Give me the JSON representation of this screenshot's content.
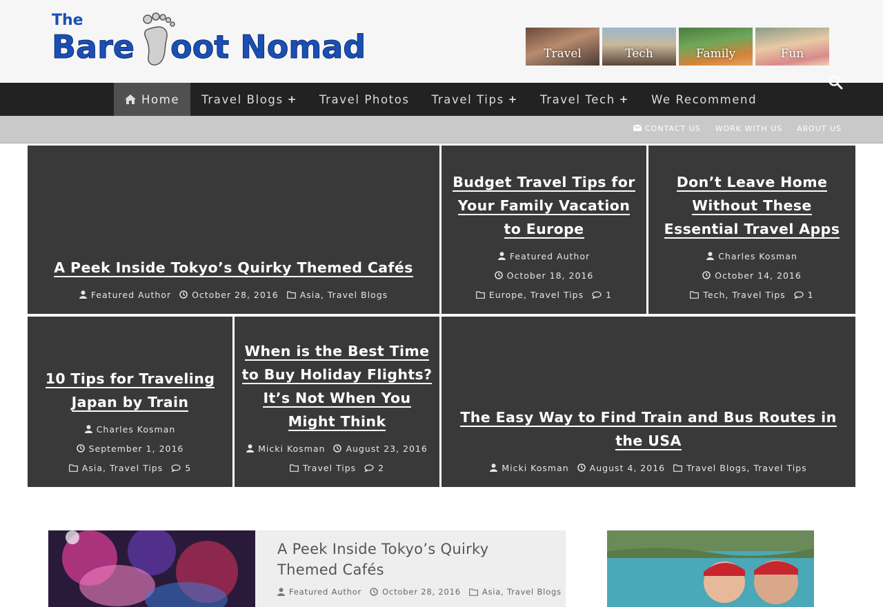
{
  "site": {
    "logo_text": "The BareFoot Nomad",
    "banner": [
      "Travel",
      "Tech",
      "Family",
      "Fun"
    ]
  },
  "nav": {
    "items": [
      {
        "label": "Home",
        "icon": "home-icon",
        "active": true,
        "has_submenu": false
      },
      {
        "label": "Travel Blogs",
        "has_submenu": true
      },
      {
        "label": "Travel Photos",
        "has_submenu": false
      },
      {
        "label": "Travel Tips",
        "has_submenu": true
      },
      {
        "label": "Travel Tech",
        "has_submenu": true
      },
      {
        "label": "We Recommend",
        "has_submenu": false
      }
    ],
    "search_icon": "search-icon"
  },
  "subnav": {
    "contact": "CONTACT US",
    "work": "WORK WITH US",
    "about": "ABOUT US"
  },
  "tiles": [
    {
      "title": "A Peek Inside Tokyo’s Quirky Themed Cafés",
      "author": "Featured Author",
      "date": "October 28, 2016",
      "categories": "Asia, Travel Blogs",
      "comments": null
    },
    {
      "title": "Budget Travel Tips for Your Family Vacation to Europe",
      "author": "Featured Author",
      "date": "October 18, 2016",
      "categories": "Europe, Travel Tips",
      "comments": "1"
    },
    {
      "title": "Don’t Leave Home Without These Essential Travel Apps",
      "author": "Charles Kosman",
      "date": "October 14, 2016",
      "categories": "Tech, Travel Tips",
      "comments": "1"
    },
    {
      "title": "10 Tips for Traveling Japan by Train",
      "author": "Charles Kosman",
      "date": "September 1, 2016",
      "categories": "Asia, Travel Tips",
      "comments": "5"
    },
    {
      "title": "When is the Best Time to Buy Holiday Flights? It’s Not When You Might Think",
      "author": "Micki Kosman",
      "date": "August 23, 2016",
      "categories": "Travel Tips",
      "comments": "2"
    },
    {
      "title": "The Easy Way to Find Train and Bus Routes in the USA",
      "author": "Micki Kosman",
      "date": "August 4, 2016",
      "categories": "Travel Blogs, Travel Tips",
      "comments": null
    }
  ],
  "latest_post": {
    "title": "A Peek Inside Tokyo’s Quirky Themed Cafés",
    "author": "Featured Author",
    "date": "October 28, 2016",
    "categories": "Asia, Travel Blogs"
  },
  "colors": {
    "logo_blue": "#1b4fb3",
    "nav_bg": "#222222",
    "nav_active": "#505050",
    "subnav_bg": "#c9c9c9",
    "tile_bg": "#393939"
  }
}
